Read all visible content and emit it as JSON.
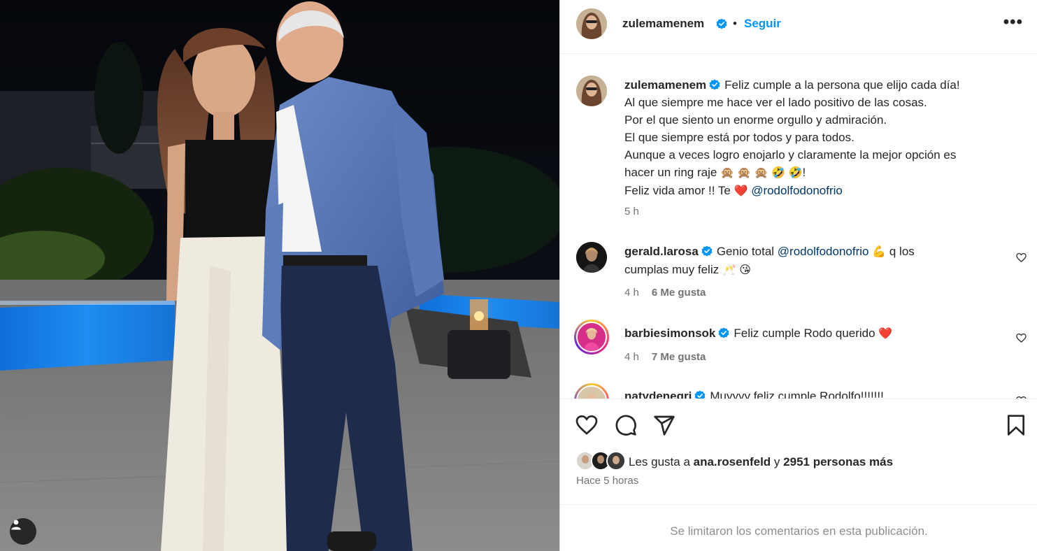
{
  "post": {
    "author": "zulemamenem",
    "follow_label": "Seguir",
    "separator": "•",
    "more_label": "•••"
  },
  "caption": {
    "author": "zulemamenem",
    "line1": "Feliz cumple a la persona que elijo cada día!",
    "line2": "Al que siempre me hace ver el lado positivo de las cosas.",
    "line3": "Por el que siento un enorme orgullo y admiración.",
    "line4": "El que siempre está por todos y para todos.",
    "line5": "Aunque a veces logro enojarlo y claramente la mejor opción es",
    "line6_text": "hacer un ring raje",
    "line6_emojis": "🙊 🙊 🙊  🤣 🤣",
    "line6_end": "!",
    "line7_text": "Feliz vida amor !! Te",
    "line7_emoji": "❤️",
    "mention": "@rodolfodonofrio",
    "time": "5 h"
  },
  "comments": [
    {
      "user": "gerald.larosa",
      "text_before": "Genio total",
      "mention": "@rodolfodonofrio",
      "emoji1": "💪",
      "text_after": "q los",
      "line2": "cumplas muy feliz",
      "emoji2": "🥂 😘",
      "time": "4 h",
      "likes": "6 Me gusta"
    },
    {
      "user": "barbiesimonsok",
      "text": "Feliz cumple Rodo querido",
      "emoji": "❤️",
      "time": "4 h",
      "likes": "7 Me gusta"
    },
    {
      "user": "natydenegri",
      "text": "Muyyyy feliz cumple Rodolfo!!!!!!!"
    }
  ],
  "likes": {
    "prefix": "Les gusta a",
    "user": "ana.rosenfeld",
    "conj": "y",
    "rest": "2951 personas más",
    "time_ago": "Hace 5 horas"
  },
  "footer": {
    "limited": "Se limitaron los comentarios en esta publicación."
  },
  "icons": {
    "verified": "verified-badge-icon",
    "like": "heart-icon",
    "comment": "comment-icon",
    "share": "share-icon",
    "save": "bookmark-icon",
    "user_tag": "user-icon"
  },
  "colors": {
    "accent": "#0095f6",
    "verified": "#0095f6",
    "mention": "#00376b",
    "muted": "#737373"
  }
}
